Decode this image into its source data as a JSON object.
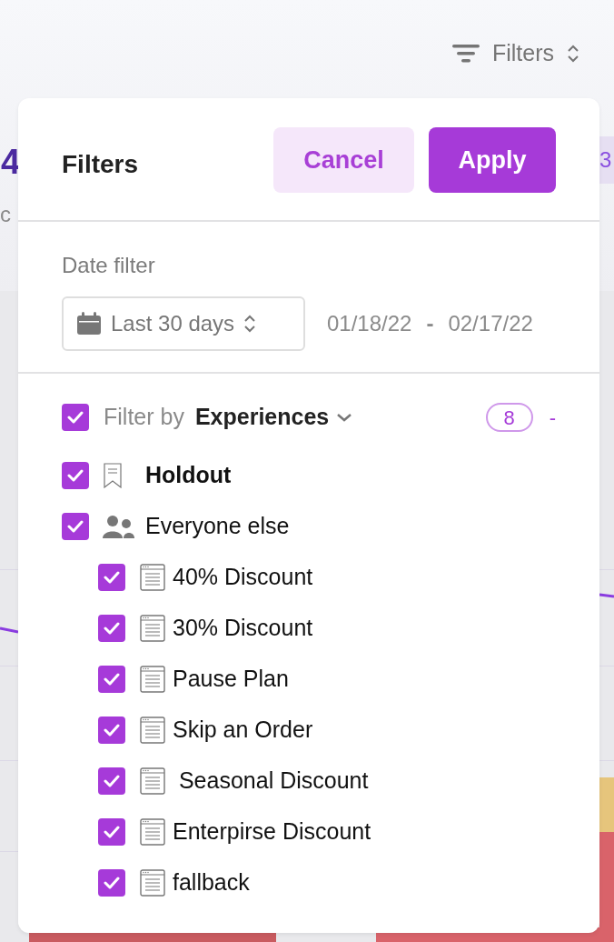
{
  "background": {
    "filters_button": {
      "label": "Filters"
    },
    "left_value": "4",
    "left_caption": "c",
    "right_badge": "3"
  },
  "modal": {
    "title": "Filters",
    "buttons": [
      {
        "label": "Cancel",
        "kind": "secondary"
      },
      {
        "label": "Apply",
        "kind": "primary"
      }
    ],
    "date_filter": {
      "label": "Date filter",
      "range": "Last 30 days",
      "start": "01/18/22",
      "separator": "-",
      "end": "02/17/22"
    },
    "filter_by": {
      "checked": true,
      "prefix": "Filter by",
      "dimension": "Experiences",
      "count": "8",
      "collapse": "-"
    },
    "items": [
      {
        "label": "Holdout",
        "kind": "holdout",
        "checked": true
      },
      {
        "label": "Everyone else",
        "kind": "group",
        "checked": true,
        "children": [
          {
            "label": "40% Discount",
            "kind": "page",
            "checked": true
          },
          {
            "label": "30% Discount",
            "kind": "page",
            "checked": true
          },
          {
            "label": "Pause Plan",
            "kind": "page",
            "checked": true
          },
          {
            "label": "Skip an Order",
            "kind": "page",
            "checked": true
          },
          {
            "label": " Seasonal Discount",
            "kind": "page",
            "checked": true
          },
          {
            "label": "Enterpirse Discount",
            "kind": "page",
            "checked": true
          },
          {
            "label": "fallback",
            "kind": "page",
            "checked": true
          }
        ]
      }
    ]
  }
}
